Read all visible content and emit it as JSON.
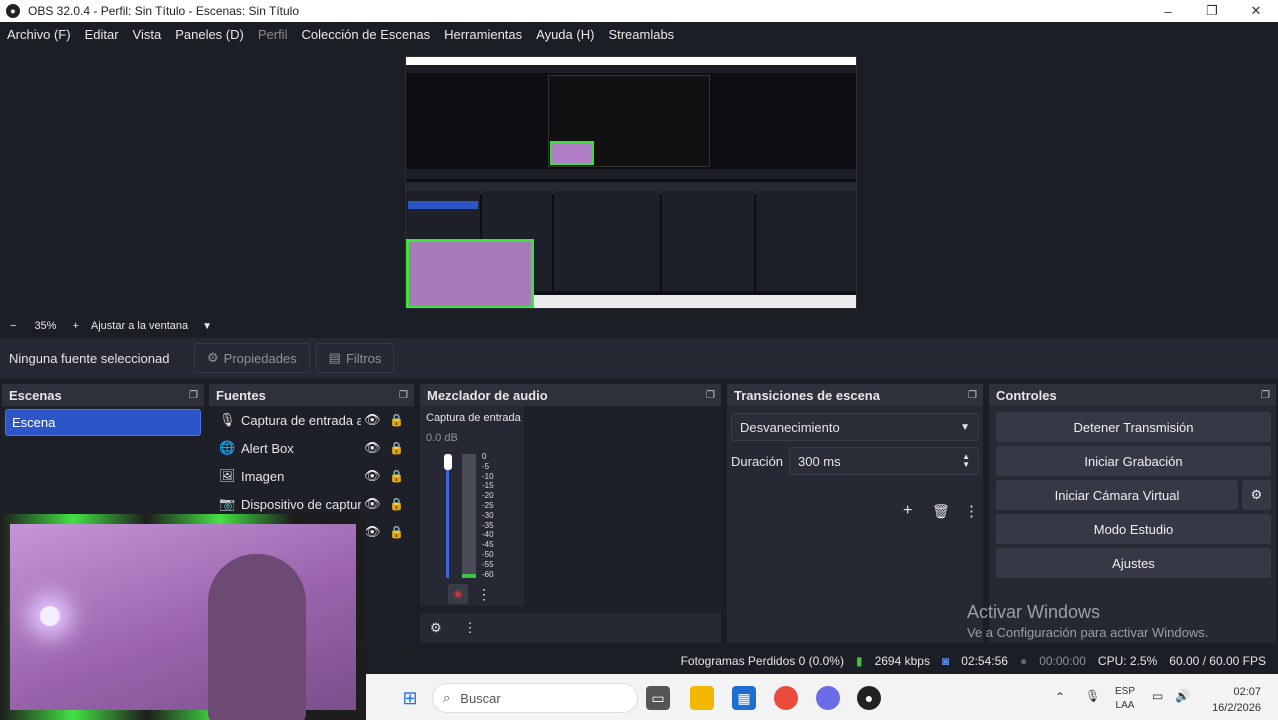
{
  "window": {
    "title": "OBS 32.0.4 - Perfil: Sin Título - Escenas: Sin Título"
  },
  "menu": [
    "Archivo (F)",
    "Editar",
    "Vista",
    "Paneles (D)",
    "Perfil",
    "Colección de Escenas",
    "Herramientas",
    "Ayuda (H)",
    "Streamlabs"
  ],
  "preview": {
    "zoom": "35%",
    "fit_label": "Ajustar a la ventana"
  },
  "source_toolbar": {
    "no_source": "Ninguna fuente seleccionad",
    "properties": "Propiedades",
    "filters": "Filtros"
  },
  "docks": {
    "scenes": {
      "title": "Escenas",
      "items": [
        "Escena"
      ]
    },
    "sources": {
      "title": "Fuentes",
      "items": [
        {
          "label": "Captura de entrada a",
          "icon": "microphone-icon"
        },
        {
          "label": "Alert Box",
          "icon": "globe-icon"
        },
        {
          "label": "Imagen",
          "icon": "image-icon"
        },
        {
          "label": "Dispositivo de captur",
          "icon": "camera-icon"
        }
      ]
    },
    "mixer": {
      "title": "Mezclador de audio",
      "channel": "Captura de entrada",
      "level": "0.0 dB",
      "scale": [
        "0",
        "-5",
        "-10",
        "-15",
        "-20",
        "-25",
        "-30",
        "-35",
        "-40",
        "-45",
        "-50",
        "-55",
        "-60"
      ]
    },
    "transitions": {
      "title": "Transiciones de escena",
      "selected": "Desvanecimiento",
      "duration_label": "Duración",
      "duration_value": "300 ms"
    },
    "controls": {
      "title": "Controles",
      "buttons": [
        "Detener Transmisión",
        "Iniciar Grabación",
        "Iniciar Cámara Virtual",
        "Modo Estudio",
        "Ajustes"
      ]
    }
  },
  "status": {
    "dropped": "Fotogramas Perdidos 0 (0.0%)",
    "bitrate": "2694 kbps",
    "stream_time": "02:54:56",
    "rec_time": "00:00:00",
    "cpu": "CPU: 2.5%",
    "fps": "60.00 / 60.00 FPS"
  },
  "watermark": {
    "line1": "Activar Windows",
    "line2": "Ve a Configuración para activar Windows."
  },
  "taskbar": {
    "search": "Buscar",
    "lang1": "ESP",
    "lang2": "LAA",
    "time": "02:07",
    "date": "16/2/2026"
  }
}
